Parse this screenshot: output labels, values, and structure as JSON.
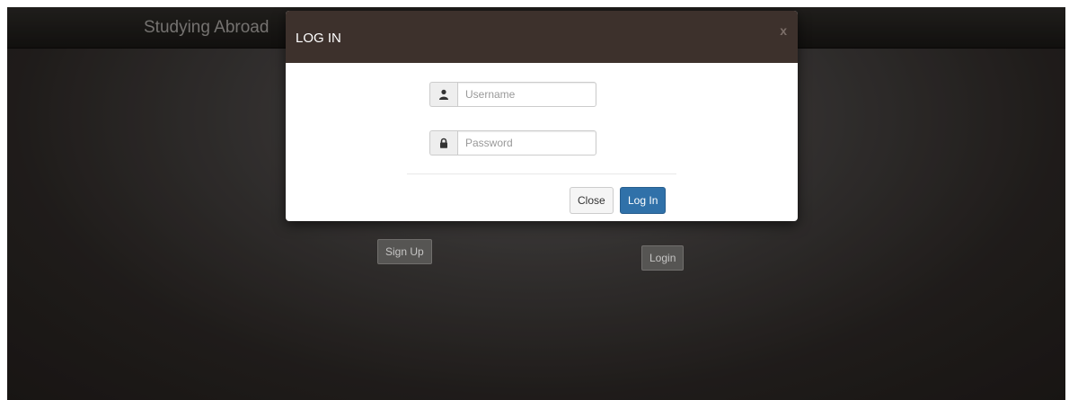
{
  "navbar": {
    "brand": "Studying Abroad"
  },
  "page_buttons": {
    "signup": "Sign Up",
    "login": "Login"
  },
  "modal": {
    "title": "LOG IN",
    "close_x": "x",
    "username": {
      "placeholder": "Username",
      "icon": "user-icon"
    },
    "password": {
      "placeholder": "Password",
      "icon": "lock-icon"
    },
    "close_label": "Close",
    "submit_label": "Log In"
  },
  "colors": {
    "modal_header": "#3d312c",
    "primary": "#3071a9",
    "background": "#2d2927"
  }
}
